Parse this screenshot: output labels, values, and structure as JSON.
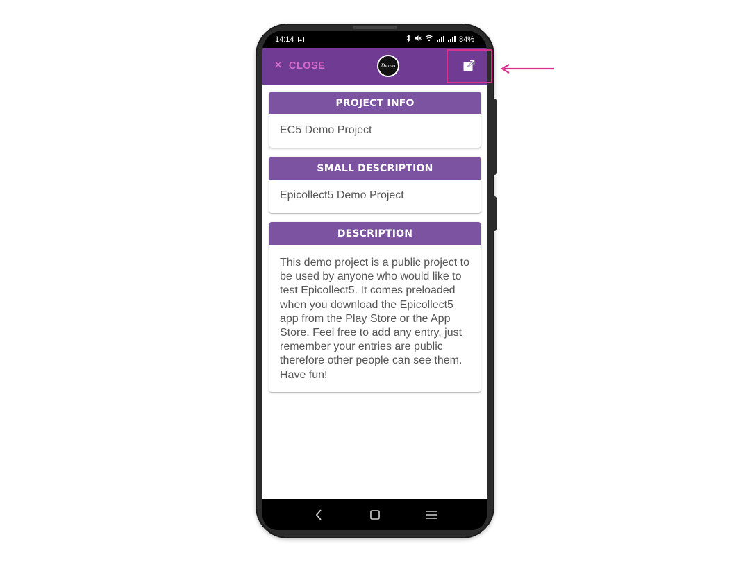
{
  "status_bar": {
    "time": "14:14",
    "battery": "84%",
    "icons": [
      "gallery-icon",
      "bluetooth-icon",
      "mute-icon",
      "wifi-icon",
      "signal-icon",
      "signal-icon"
    ]
  },
  "app_bar": {
    "close_label": "CLOSE",
    "close_icon": "close-icon",
    "logo_text": "Demo",
    "open_icon": "open-in-new-icon"
  },
  "sections": [
    {
      "header": "PROJECT INFO",
      "body": "EC5 Demo Project"
    },
    {
      "header": "SMALL DESCRIPTION",
      "body": "Epicollect5 Demo Project"
    },
    {
      "header": "DESCRIPTION",
      "body": "This demo project is a public project to be used by anyone who would like to test Epicollect5. It comes preloaded when you download the Epicollect5 app from the Play Store or the App Store. Feel free to add any entry, just remember your entries are public therefore other people can see them. Have fun!"
    }
  ],
  "nav_bar": {
    "icons": [
      "back-icon",
      "home-icon",
      "recents-icon"
    ]
  },
  "colors": {
    "app_bar": "#6f3b93",
    "card_header": "#7b53a0",
    "close_text": "#d569c7",
    "annotation": "#d6338f"
  }
}
